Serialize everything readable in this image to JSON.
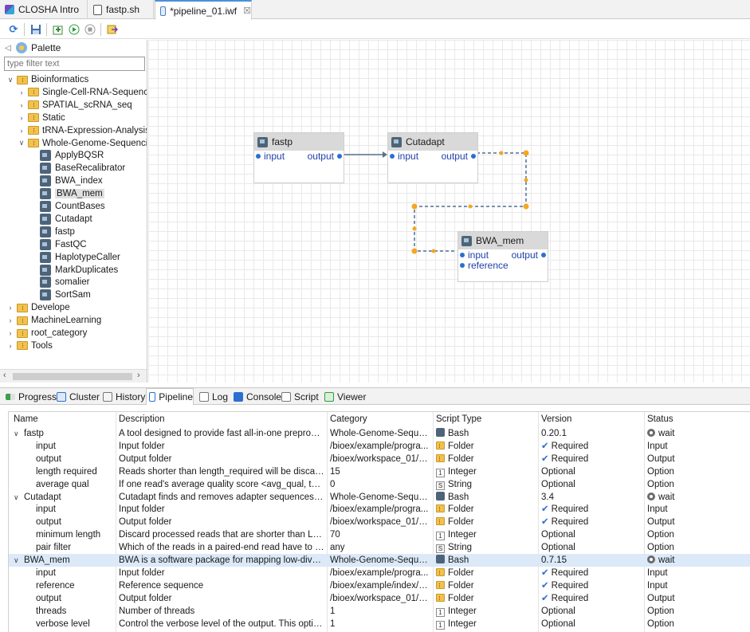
{
  "tabs": [
    {
      "label": "CLOSHA Intro",
      "icon": "closha-logo-icon"
    },
    {
      "label": "fastp.sh",
      "icon": "script-file-icon"
    },
    {
      "label": "*pipeline_01.iwf",
      "icon": "pipeline-file-icon",
      "close": "☒"
    }
  ],
  "palette": {
    "title": "Palette",
    "filter_placeholder": "type filter text",
    "tree": [
      {
        "label": "Bioinformatics",
        "kind": "folder",
        "level": 0,
        "open": true
      },
      {
        "label": "Single-Cell-RNA-Sequencir",
        "kind": "folder",
        "level": 1,
        "open": false
      },
      {
        "label": "SPATIAL_scRNA_seq",
        "kind": "folder",
        "level": 1,
        "open": false
      },
      {
        "label": "Static",
        "kind": "folder",
        "level": 1,
        "open": false
      },
      {
        "label": "tRNA-Expression-Analysis",
        "kind": "folder",
        "level": 1,
        "open": false
      },
      {
        "label": "Whole-Genome-Sequencin",
        "kind": "folder",
        "level": 1,
        "open": true
      },
      {
        "label": "ApplyBQSR",
        "kind": "tool",
        "level": 2
      },
      {
        "label": "BaseRecalibrator",
        "kind": "tool",
        "level": 2
      },
      {
        "label": "BWA_index",
        "kind": "tool",
        "level": 2
      },
      {
        "label": "BWA_mem",
        "kind": "tool",
        "level": 2,
        "selected": true
      },
      {
        "label": "CountBases",
        "kind": "tool",
        "level": 2
      },
      {
        "label": "Cutadapt",
        "kind": "tool",
        "level": 2
      },
      {
        "label": "fastp",
        "kind": "tool",
        "level": 2
      },
      {
        "label": "FastQC",
        "kind": "tool",
        "level": 2
      },
      {
        "label": "HaplotypeCaller",
        "kind": "tool",
        "level": 2
      },
      {
        "label": "MarkDuplicates",
        "kind": "tool",
        "level": 2
      },
      {
        "label": "somalier",
        "kind": "tool",
        "level": 2
      },
      {
        "label": "SortSam",
        "kind": "tool",
        "level": 2
      },
      {
        "label": "Develope",
        "kind": "folder",
        "level": 0,
        "open": false
      },
      {
        "label": "MachineLearning",
        "kind": "folder",
        "level": 0,
        "open": false
      },
      {
        "label": "root_category",
        "kind": "folder",
        "level": 0,
        "open": false
      },
      {
        "label": "Tools",
        "kind": "folder",
        "level": 0,
        "open": false
      }
    ]
  },
  "nodes": {
    "fastp": {
      "title": "fastp",
      "in": "input",
      "out": "output"
    },
    "cutadapt": {
      "title": "Cutadapt",
      "in": "input",
      "out": "output"
    },
    "bwa": {
      "title": "BWA_mem",
      "in": "input",
      "in2": "reference",
      "out": "output"
    }
  },
  "view_tabs": [
    {
      "label": "Progress",
      "active": false
    },
    {
      "label": "Cluster",
      "active": false
    },
    {
      "label": "History",
      "active": false
    },
    {
      "label": "Pipeline",
      "active": true
    },
    {
      "label": "Log",
      "active": false
    },
    {
      "label": "Console",
      "active": false
    },
    {
      "label": "Script",
      "active": false
    },
    {
      "label": "Viewer",
      "active": false
    }
  ],
  "table": {
    "columns": [
      "Name",
      "Description",
      "Category",
      "Script Type",
      "Version",
      "Status"
    ],
    "rows": [
      {
        "type": "group",
        "name": "fastp",
        "desc": "A tool designed to provide fast all-in-one preproces...",
        "cat": "Whole-Genome-Sequen...",
        "stype": "Bash",
        "stype_icon": "bash",
        "version": "0.20.1",
        "status": "wait"
      },
      {
        "type": "param",
        "name": "input",
        "desc": "Input folder",
        "cat": "/bioex/example/progra...",
        "stype": "Folder",
        "stype_icon": "folder",
        "version": "Required",
        "req": true,
        "status": "Input"
      },
      {
        "type": "param",
        "name": "output",
        "desc": "Output folder",
        "cat": "/bioex/workspace_01/pi...",
        "stype": "Folder",
        "stype_icon": "folder",
        "version": "Required",
        "req": true,
        "status": "Output"
      },
      {
        "type": "param",
        "name": "length required",
        "desc": "Reads shorter than length_required will be discarded",
        "cat": "15",
        "stype": "Integer",
        "stype_icon": "int",
        "version": "Optional",
        "req": false,
        "status": "Option"
      },
      {
        "type": "param",
        "name": "average qual",
        "desc": "If one read's average quality score <avg_qual, then t...",
        "cat": "0",
        "stype": "String",
        "stype_icon": "str",
        "version": "Optional",
        "req": false,
        "status": "Option"
      },
      {
        "type": "group",
        "name": "Cutadapt",
        "desc": "Cutadapt finds and removes adapter sequences, pri...",
        "cat": "Whole-Genome-Sequen...",
        "stype": "Bash",
        "stype_icon": "bash",
        "version": "3.4",
        "status": "wait"
      },
      {
        "type": "param",
        "name": "input",
        "desc": "Input folder",
        "cat": "/bioex/example/progra...",
        "stype": "Folder",
        "stype_icon": "folder",
        "version": "Required",
        "req": true,
        "status": "Input"
      },
      {
        "type": "param",
        "name": "output",
        "desc": "Output folder",
        "cat": "/bioex/workspace_01/pi...",
        "stype": "Folder",
        "stype_icon": "folder",
        "version": "Required",
        "req": true,
        "status": "Output"
      },
      {
        "type": "param",
        "name": "minimum length",
        "desc": "Discard processed reads that are shorter than LENGTH",
        "cat": "70",
        "stype": "Integer",
        "stype_icon": "int",
        "version": "Optional",
        "req": false,
        "status": "Option"
      },
      {
        "type": "param",
        "name": "pair filter",
        "desc": "Which of the reads in a paired-end read have to ma...",
        "cat": "any",
        "stype": "String",
        "stype_icon": "str",
        "version": "Optional",
        "req": false,
        "status": "Option"
      },
      {
        "type": "group",
        "name": "BWA_mem",
        "desc": "BWA is a software package for mapping low-diverge...",
        "cat": "Whole-Genome-Sequen...",
        "stype": "Bash",
        "stype_icon": "bash",
        "version": "0.7.15",
        "status": "wait",
        "highlight": true
      },
      {
        "type": "param",
        "name": "input",
        "desc": "Input folder",
        "cat": "/bioex/example/progra...",
        "stype": "Folder",
        "stype_icon": "folder",
        "version": "Required",
        "req": true,
        "status": "Input"
      },
      {
        "type": "param",
        "name": "reference",
        "desc": "Reference sequence",
        "cat": "/bioex/example/index/B...",
        "stype": "Folder",
        "stype_icon": "folder",
        "version": "Required",
        "req": true,
        "status": "Input"
      },
      {
        "type": "param",
        "name": "output",
        "desc": "Output folder",
        "cat": "/bioex/workspace_01/pi...",
        "stype": "Folder",
        "stype_icon": "folder",
        "version": "Required",
        "req": true,
        "status": "Output"
      },
      {
        "type": "param",
        "name": "threads",
        "desc": "Number of threads",
        "cat": "1",
        "stype": "Integer",
        "stype_icon": "int",
        "version": "Optional",
        "req": false,
        "status": "Option"
      },
      {
        "type": "param",
        "name": "verbose level",
        "desc": "Control the verbose level of the output. This option ...",
        "cat": "1",
        "stype": "Integer",
        "stype_icon": "int",
        "version": "Optional",
        "req": false,
        "status": "Option"
      }
    ]
  },
  "colors": {
    "accent": "#2b6fd0",
    "wire": "#5a6f88",
    "handle": "#f5a623",
    "highlight": "#dbe9f8"
  }
}
